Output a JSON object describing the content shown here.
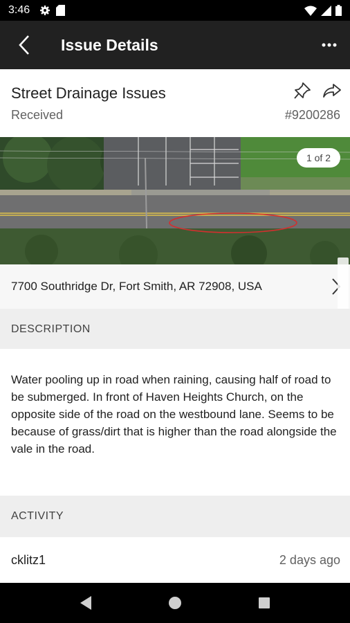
{
  "status_bar": {
    "time": "3:46",
    "icons_left": [
      "gear-icon",
      "sd-card-icon"
    ],
    "icons_right": [
      "wifi-icon",
      "signal-icon",
      "battery-icon"
    ]
  },
  "app_bar": {
    "title": "Issue Details",
    "back_icon": "back-chevron-icon",
    "more_icon": "more-vertical-dots-icon"
  },
  "issue": {
    "title": "Street Drainage Issues",
    "status": "Received",
    "id": "#9200286"
  },
  "photo": {
    "counter": "1 of 2"
  },
  "address": {
    "text": "7700 Southridge Dr, Fort Smith, AR 72908, USA"
  },
  "description": {
    "header": "DESCRIPTION",
    "text": "Water pooling up in road when raining, causing half of road to be submerged. In front of Haven Heights Church, on the opposite side of the road on the westbound lane. Seems to be because of grass/dirt that is higher than the road alongside the vale in the road."
  },
  "activity": {
    "header": "ACTIVITY",
    "items": [
      {
        "user": "cklitz1",
        "time": "2 days ago"
      }
    ]
  },
  "colors": {
    "app_bar": "#212121",
    "section_bg": "#eeeeee",
    "highlight_ellipse": "#d32f2f"
  }
}
